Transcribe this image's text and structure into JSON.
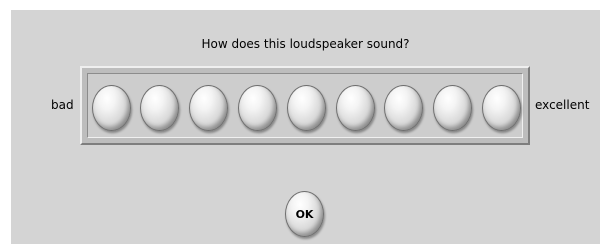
{
  "question": "How does this loudspeaker sound?",
  "scale": {
    "low_label": "bad",
    "high_label": "excellent",
    "point_count": 9
  },
  "ok_button": {
    "label": "OK"
  }
}
